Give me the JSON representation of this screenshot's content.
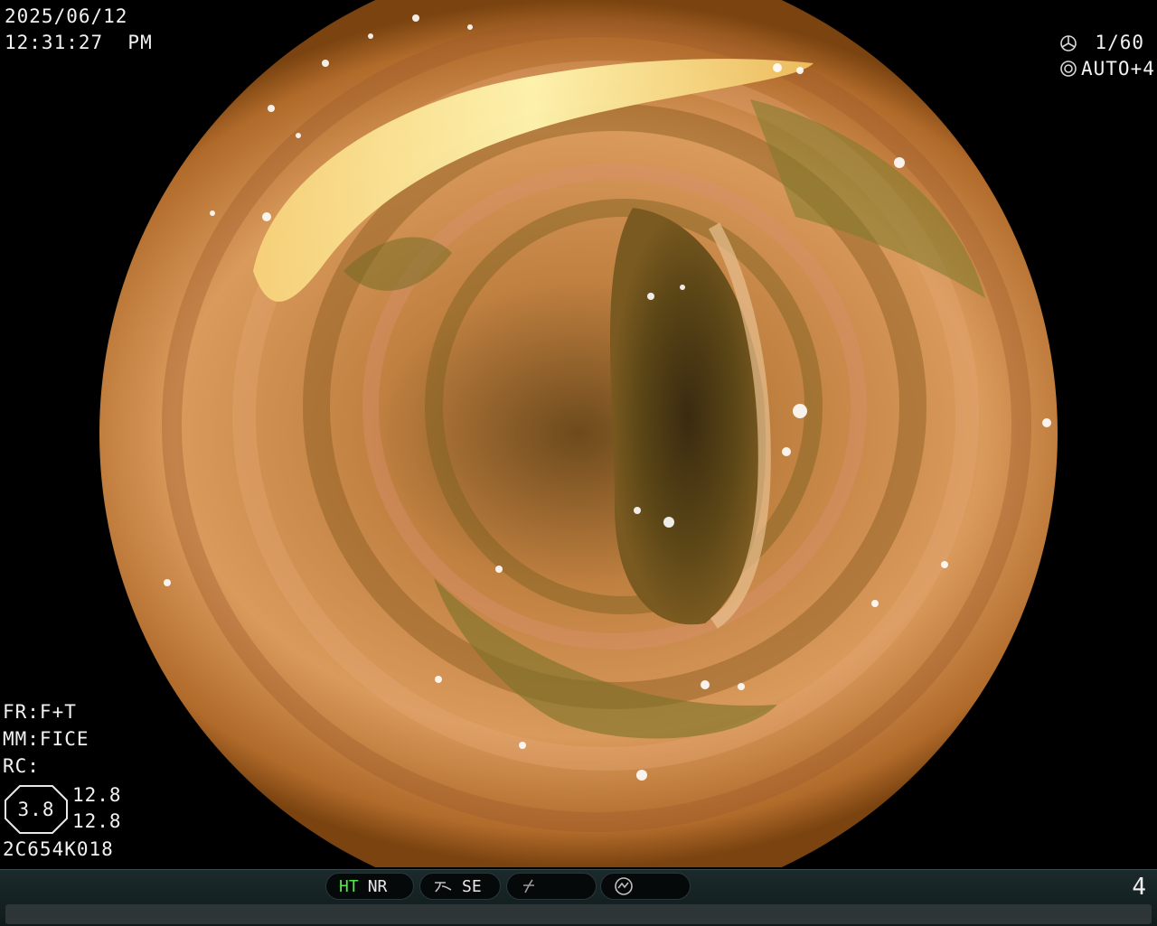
{
  "overlay": {
    "date": "2025/06/12",
    "time": "12:31:27  PM",
    "shutter": "1/60",
    "iris": "AUTO+4",
    "fr": "FR:F+T",
    "mm": "MM:FICE",
    "rc": "RC:",
    "zoom_value": "3.8",
    "value_top": "12.8",
    "value_bottom": "12.8",
    "scope_id": "2C654K018"
  },
  "status_bar": {
    "ht": "HT",
    "nr": "NR",
    "se": "SE",
    "page": "4"
  },
  "colors": {
    "ht_active": "#55e84a",
    "text": "#f2f2f2",
    "bar": "#1b2a2c"
  }
}
